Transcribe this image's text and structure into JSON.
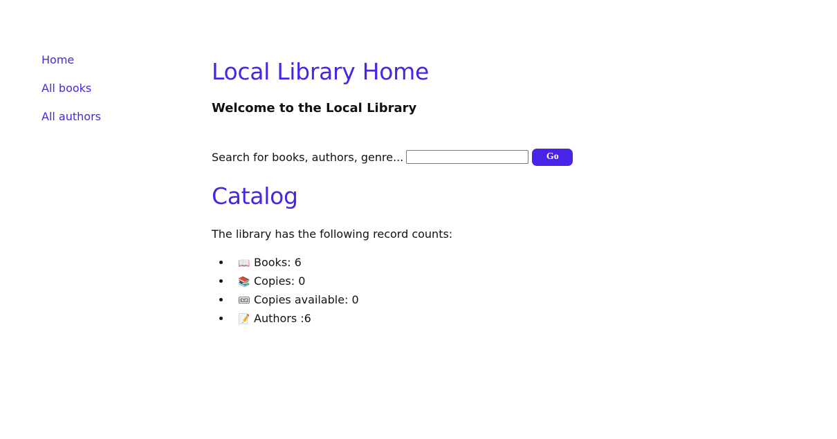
{
  "sidebar": {
    "items": [
      {
        "label": "Home"
      },
      {
        "label": "All books"
      },
      {
        "label": "All authors"
      }
    ]
  },
  "main": {
    "title": "Local Library Home",
    "welcome": "Welcome to the Local Library",
    "search": {
      "label": "Search for books, authors, genre...",
      "value": "",
      "button_label": "Go"
    },
    "catalog": {
      "title": "Catalog",
      "intro": "The library has the following record counts:",
      "items": [
        {
          "icon": "open-book-icon",
          "glyph": "📖",
          "text": "Books: 6"
        },
        {
          "icon": "books-icon",
          "glyph": "📚",
          "text": "Copies: 0"
        },
        {
          "icon": "ticket-icon",
          "glyph": "🎟",
          "text": "Copies available: 0"
        },
        {
          "icon": "memo-icon",
          "glyph": "📝",
          "text": "Authors :6"
        }
      ]
    }
  },
  "colors": {
    "accent": "#4a24e6",
    "text": "#111111",
    "background": "#ffffff"
  }
}
